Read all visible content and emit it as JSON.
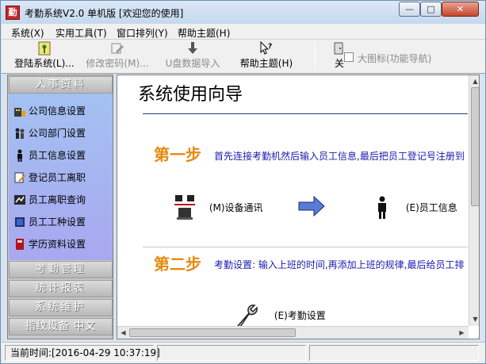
{
  "window": {
    "title": "考勤系统V2.0 单机版 [欢迎您的使用]",
    "app_icon_text": "勤",
    "min_glyph": "—",
    "max_glyph": "□",
    "close_glyph": "✕"
  },
  "menu": [
    "系统(X)",
    "实用工具(T)",
    "窗口排列(Y)",
    "帮助主题(H)"
  ],
  "toolbar": {
    "buttons": [
      {
        "label": "登陆系统(L)...",
        "icon": "key-icon",
        "enabled": true
      },
      {
        "label": "修改密码(M)...",
        "icon": "edit-icon",
        "enabled": false
      },
      {
        "label": "U盘数据导入",
        "icon": "down-arrow-icon",
        "enabled": false
      },
      {
        "label": "帮助主题(H)",
        "icon": "help-pointer-icon",
        "enabled": true
      },
      {
        "label": "关",
        "icon": "exit-icon",
        "enabled": true
      }
    ],
    "big_icon_checkbox_label": "大图标(功能导航)"
  },
  "sidebar": {
    "sections": [
      "人事资料",
      "考勤管理",
      "统计报表",
      "系统维护",
      "指纹设备 中文"
    ],
    "items": [
      {
        "label": "公司信息设置",
        "icon": "company-icon"
      },
      {
        "label": "公司部门设置",
        "icon": "department-icon"
      },
      {
        "label": "员工信息设置",
        "icon": "person-icon"
      },
      {
        "label": "登记员工离职",
        "icon": "register-leave-icon"
      },
      {
        "label": "员工离职查询",
        "icon": "query-icon"
      },
      {
        "label": "员工工种设置",
        "icon": "job-type-icon"
      },
      {
        "label": "学历资料设置",
        "icon": "education-icon"
      }
    ]
  },
  "main": {
    "title": "系统使用向导",
    "steps": [
      {
        "title": "第一步",
        "desc": "首先连接考勤机然后输入员工信息,最后把员工登记号注册到",
        "flow": [
          {
            "label": "(M)设备通讯",
            "icon": "device-comm-icon"
          },
          {
            "label": "(E)员工信息",
            "icon": "person-icon"
          }
        ]
      },
      {
        "title": "第二步",
        "desc": "考勤设置: 输入上班的时间,再添加上班的规律,最后给员工排",
        "flow": [
          {
            "label": "(E)考勤设置",
            "icon": "wrench-icon"
          }
        ]
      }
    ]
  },
  "status": {
    "time_label": "当前时间:",
    "time_value": "[2016-04-29 10:37:19]"
  },
  "colors": {
    "step_title": "#e58a10",
    "step_desc": "#1a1ab0",
    "sidebar_gradient_top": "#a4c1f2",
    "sidebar_gradient_bottom": "#a8a8f0"
  }
}
